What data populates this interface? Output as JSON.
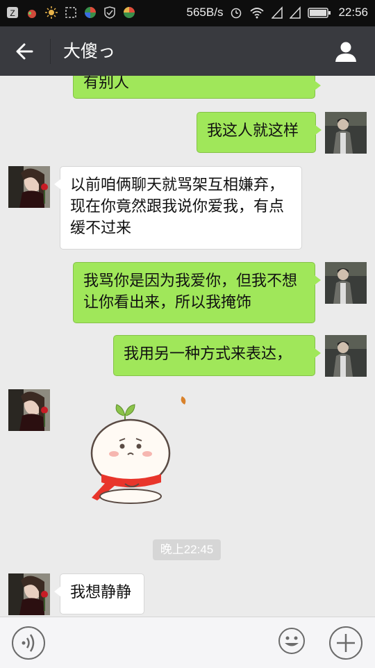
{
  "status_bar": {
    "icons": [
      "z-app-icon",
      "fruit-app-icon",
      "brightness-icon",
      "screenshot-icon",
      "app-icon-1",
      "app-icon-2",
      "app-icon-3"
    ],
    "net_speed": "565B/s",
    "time": "22:56"
  },
  "header": {
    "title": "大傻っ"
  },
  "messages": [
    {
      "side": "right",
      "text": "有别人"
    },
    {
      "side": "right",
      "text": "我这人就这样"
    },
    {
      "side": "left",
      "text": "以前咱俩聊天就骂架互相嫌弃，现在你竟然跟我说你爱我，有点缓不过来"
    },
    {
      "side": "right",
      "text": "我骂你是因为我爱你，但我不想让你看出来，所以我掩饰"
    },
    {
      "side": "right",
      "text": "我用另一种方式来表达，"
    },
    {
      "side": "left",
      "type": "sticker",
      "sticker": "sad-bun-sticker"
    },
    {
      "side": "left",
      "text": "我想静静"
    }
  ],
  "timestamp": "晚上22:45",
  "colors": {
    "accent_bubble": "#a0e75a",
    "header_bg": "#393a3f"
  }
}
